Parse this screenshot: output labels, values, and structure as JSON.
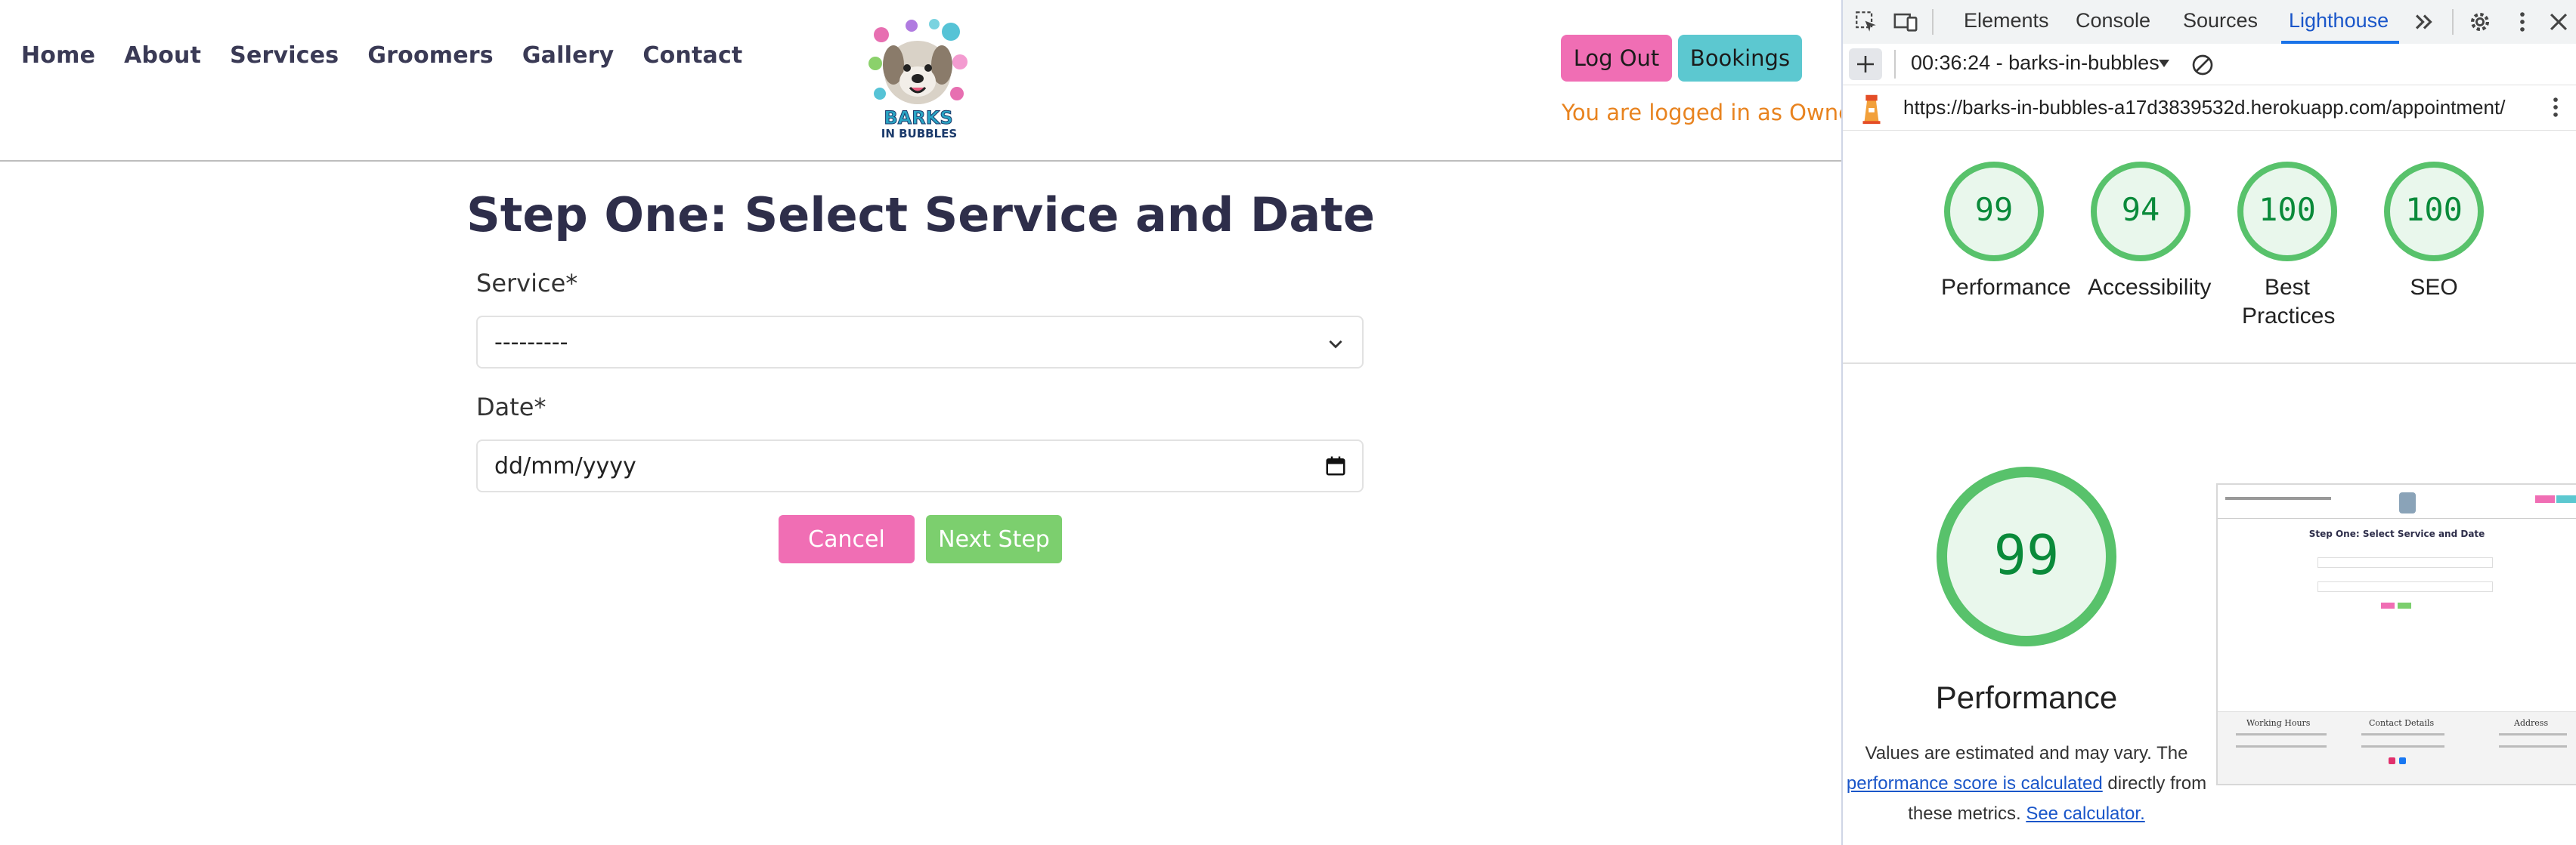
{
  "site": {
    "nav": [
      "Home",
      "About",
      "Services",
      "Groomers",
      "Gallery",
      "Contact"
    ],
    "logo_line1": "BARKS",
    "logo_line2": "IN BUBBLES",
    "logout_label": "Log Out",
    "bookings_label": "Bookings",
    "logged_in_message": "You are logged in as Owner",
    "page_title": "Step One: Select Service and Date",
    "service_label": "Service*",
    "service_value": "---------",
    "date_label": "Date*",
    "date_placeholder": "dd/mm/yyyy",
    "cancel_label": "Cancel",
    "next_label": "Next Step",
    "colors": {
      "pink": "#f06eb4",
      "cyan": "#5cc8d0",
      "green": "#7ccf6e",
      "orange": "#e8831f",
      "title": "#2e2e4a"
    }
  },
  "devtools": {
    "tabs": [
      "Elements",
      "Console",
      "Sources",
      "Lighthouse"
    ],
    "active_tab": "Lighthouse",
    "session": "00:36:24 - barks-in-bubbles",
    "url": "https://barks-in-bubbles-a17d3839532d.herokuapp.com/appointment/",
    "scores": [
      {
        "label": "Performance",
        "value": 99
      },
      {
        "label": "Accessibility",
        "value": 94
      },
      {
        "label": "Best Practices",
        "value": 100
      },
      {
        "label": "SEO",
        "value": 100
      }
    ],
    "big_score": 99,
    "perf_title": "Performance",
    "desc_part1": "Values are estimated and may vary. The",
    "desc_link1": "performance score is calculated",
    "desc_part2": "directly from these metrics.",
    "desc_link2": "See calculator.",
    "thumb": {
      "title": "Step One: Select Service and Date",
      "footer_cols": [
        "Working Hours",
        "Contact Details",
        "Address"
      ]
    },
    "colors": {
      "gauge_green": "#0cce6b",
      "gauge_stroke": "#58c26b",
      "gauge_fill": "#e9f7ec",
      "score_text": "#0a8a3a",
      "link": "#1a56c9"
    }
  }
}
